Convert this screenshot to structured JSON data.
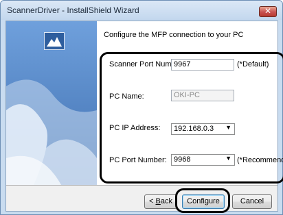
{
  "window": {
    "title": "ScannerDriver - InstallShield Wizard",
    "close_glyph": "✕"
  },
  "content": {
    "heading": "Configure the MFP connection to your PC"
  },
  "form": {
    "scanner_port": {
      "label": "Scanner Port Number:",
      "value": "9967",
      "hint": "(*Default)"
    },
    "pc_name": {
      "label": "PC Name:",
      "value": "OKI-PC"
    },
    "pc_ip": {
      "label": "PC IP Address:",
      "value": "192.168.0.3",
      "caret": "▼"
    },
    "pc_port": {
      "label": "PC Port Number:",
      "value": "9968",
      "hint": "(*Recommended)",
      "caret": "▼"
    }
  },
  "buttons": {
    "back_prefix": "< ",
    "back_mnemonic": "B",
    "back_rest": "ack",
    "configure": "Configure",
    "cancel": "Cancel"
  },
  "colors": {
    "side_panel": "#4f84c9",
    "highlight": "#000000",
    "title_close": "#c75050"
  }
}
